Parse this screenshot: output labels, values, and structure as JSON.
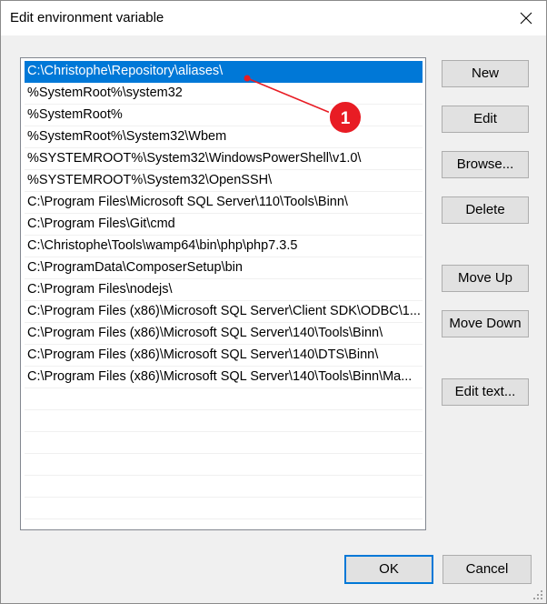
{
  "window": {
    "title": "Edit environment variable"
  },
  "list": {
    "selected_index": 0,
    "items": [
      "C:\\Christophe\\Repository\\aliases\\",
      "%SystemRoot%\\system32",
      "%SystemRoot%",
      "%SystemRoot%\\System32\\Wbem",
      "%SYSTEMROOT%\\System32\\WindowsPowerShell\\v1.0\\",
      "%SYSTEMROOT%\\System32\\OpenSSH\\",
      "C:\\Program Files\\Microsoft SQL Server\\110\\Tools\\Binn\\",
      "C:\\Program Files\\Git\\cmd",
      "C:\\Christophe\\Tools\\wamp64\\bin\\php\\php7.3.5",
      "C:\\ProgramData\\ComposerSetup\\bin",
      "C:\\Program Files\\nodejs\\",
      "C:\\Program Files (x86)\\Microsoft SQL Server\\Client SDK\\ODBC\\1...",
      "C:\\Program Files (x86)\\Microsoft SQL Server\\140\\Tools\\Binn\\",
      "C:\\Program Files (x86)\\Microsoft SQL Server\\140\\DTS\\Binn\\",
      "C:\\Program Files (x86)\\Microsoft SQL Server\\140\\Tools\\Binn\\Ma..."
    ],
    "empty_row_count": 6
  },
  "buttons": {
    "new": "New",
    "edit": "Edit",
    "browse": "Browse...",
    "delete": "Delete",
    "move_up": "Move Up",
    "move_down": "Move Down",
    "edit_text": "Edit text...",
    "ok": "OK",
    "cancel": "Cancel"
  },
  "annotation": {
    "label": "1",
    "color": "#e81c24"
  },
  "colors": {
    "selection": "#0078d7",
    "button_face": "#e1e1e1",
    "dialog_background": "#f0f0f0"
  },
  "icons": {
    "close": "close-icon",
    "grip": "resize-grip-icon"
  }
}
